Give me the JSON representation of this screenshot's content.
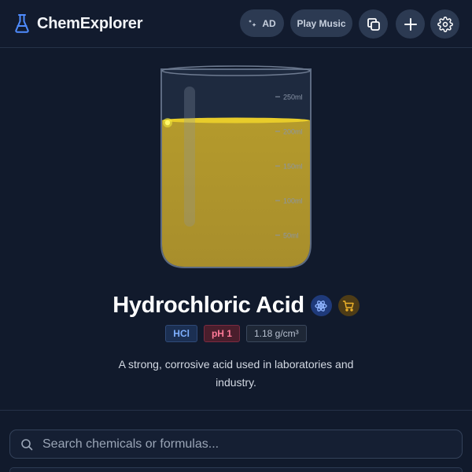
{
  "app": {
    "name": "ChemExplorer"
  },
  "header": {
    "ad_label": "AD",
    "music_label": "Play Music"
  },
  "beaker": {
    "marks": [
      "250ml",
      "200ml",
      "150ml",
      "100ml",
      "50ml"
    ],
    "liquid_color": "#c8a72a",
    "surface_color": "#e8cc2a"
  },
  "chemical": {
    "name": "Hydrochloric Acid",
    "formula": "HCl",
    "ph": "pH 1",
    "density": "1.18 g/cm³",
    "description": "A strong, corrosive acid used in laboratories and industry."
  },
  "search": {
    "placeholder": "Search chemicals or formulas..."
  },
  "colors": {
    "background": "#111a2c",
    "accent": "#4f8cff",
    "ph_badge": "#ff7a98",
    "formula_badge": "#7fb0ff"
  }
}
